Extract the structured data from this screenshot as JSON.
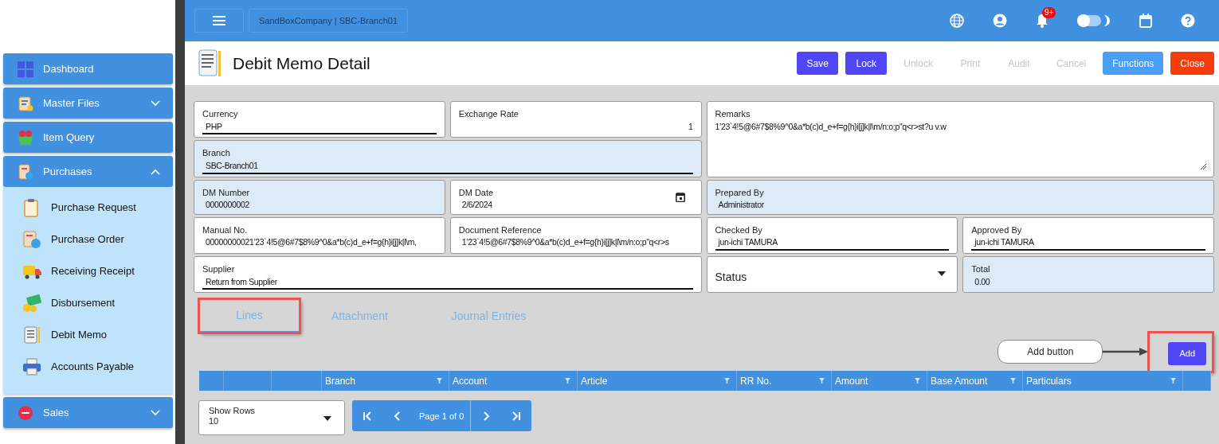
{
  "sidebar": {
    "items": [
      {
        "label": "Dashboard"
      },
      {
        "label": "Master Files",
        "expanded": false
      },
      {
        "label": "Item Query"
      },
      {
        "label": "Purchases",
        "expanded": true,
        "children": [
          {
            "label": "Purchase Request"
          },
          {
            "label": "Purchase Order"
          },
          {
            "label": "Receiving Receipt"
          },
          {
            "label": "Disbursement"
          },
          {
            "label": "Debit Memo"
          },
          {
            "label": "Accounts Payable"
          }
        ]
      },
      {
        "label": "Sales",
        "expanded": false
      }
    ]
  },
  "topbar": {
    "company": "SandBoxCompany | SBC-Branch01",
    "notifications": "9+",
    "dark_mode": {
      "on": false
    }
  },
  "header": {
    "title": "Debit Memo Detail",
    "buttons": [
      {
        "label": "Save",
        "kind": "primary",
        "disabled": false
      },
      {
        "label": "Lock",
        "kind": "primary",
        "disabled": false
      },
      {
        "label": "Unlock",
        "kind": "plain",
        "disabled": true
      },
      {
        "label": "Print",
        "kind": "plain",
        "disabled": true
      },
      {
        "label": "Audit",
        "kind": "plain",
        "disabled": true
      },
      {
        "label": "Cancel",
        "kind": "plain",
        "disabled": true
      },
      {
        "label": "Functions",
        "kind": "info",
        "disabled": false
      },
      {
        "label": "Close",
        "kind": "danger",
        "disabled": false
      }
    ]
  },
  "form": {
    "fields": [
      {
        "label": "Currency",
        "value": "PHP",
        "kind": "lookup",
        "readonly": false
      },
      {
        "label": "Exchange Rate",
        "value": "1",
        "kind": "number",
        "readonly": false
      },
      {
        "label": "Remarks",
        "value": "1’23`4!5@6#7$8%9^0&a*b(c)d_e+f=g{h}i[j]k|l\\m/n:o;p\"q<r>st?u v.w",
        "kind": "textarea",
        "readonly": false
      },
      {
        "label": "Branch",
        "value": "SBC-Branch01",
        "kind": "lookup",
        "readonly": true
      },
      {
        "label": "DM Number",
        "value": "0000000002",
        "kind": "text",
        "readonly": true
      },
      {
        "label": "DM Date",
        "value": "2/6/2024",
        "kind": "date",
        "readonly": false
      },
      {
        "label": "Prepared By",
        "value": "Administrator",
        "kind": "text",
        "readonly": true
      },
      {
        "label": "Manual No.",
        "value": "00000000021’23`4!5@6#7$8%9^0&a*b(c)d_e+f=g{h}i[j]k|l\\m,",
        "kind": "text",
        "readonly": false
      },
      {
        "label": "Document Reference",
        "value": "1’23`4!5@6#7$8%9^0&a*b(c)d_e+f=g{h}i[j]k|l\\m/n:o;p\"q<r>s",
        "kind": "text",
        "readonly": false
      },
      {
        "label": "Checked By",
        "value": "jun-ichi TAMURA",
        "kind": "lookup",
        "readonly": false
      },
      {
        "label": "Approved By",
        "value": "jun-ichi TAMURA",
        "kind": "lookup",
        "readonly": false
      },
      {
        "label": "Supplier",
        "value": "Return from Supplier",
        "kind": "lookup",
        "readonly": false
      },
      {
        "label": "Status",
        "kind": "select",
        "readonly": false
      },
      {
        "label": "Total",
        "value": "0.00",
        "kind": "text",
        "readonly": true
      }
    ]
  },
  "tabs": [
    {
      "label": "Lines",
      "selected": true,
      "highlighted": true
    },
    {
      "label": "Attachment",
      "selected": false,
      "highlighted": false
    },
    {
      "label": "Journal Entries",
      "selected": false,
      "highlighted": false
    }
  ],
  "add_button": {
    "label": "Add",
    "highlighted": true,
    "callout": "Add button"
  },
  "table": {
    "columns": [
      {
        "filter": false
      },
      {
        "filter": false
      },
      {
        "filter": false
      },
      {
        "label": "Branch",
        "filter": true
      },
      {
        "label": "Account",
        "filter": true
      },
      {
        "label": "Article",
        "filter": true
      },
      {
        "label": "RR No.",
        "filter": true
      },
      {
        "label": "Amount",
        "filter": true
      },
      {
        "label": "Base Amount",
        "filter": true
      },
      {
        "label": "Particulars",
        "filter": true
      },
      {
        "filter": false
      }
    ]
  },
  "pager": {
    "rows_label": "Show Rows",
    "rows_value": "10",
    "page": "Page 1 of 0"
  }
}
